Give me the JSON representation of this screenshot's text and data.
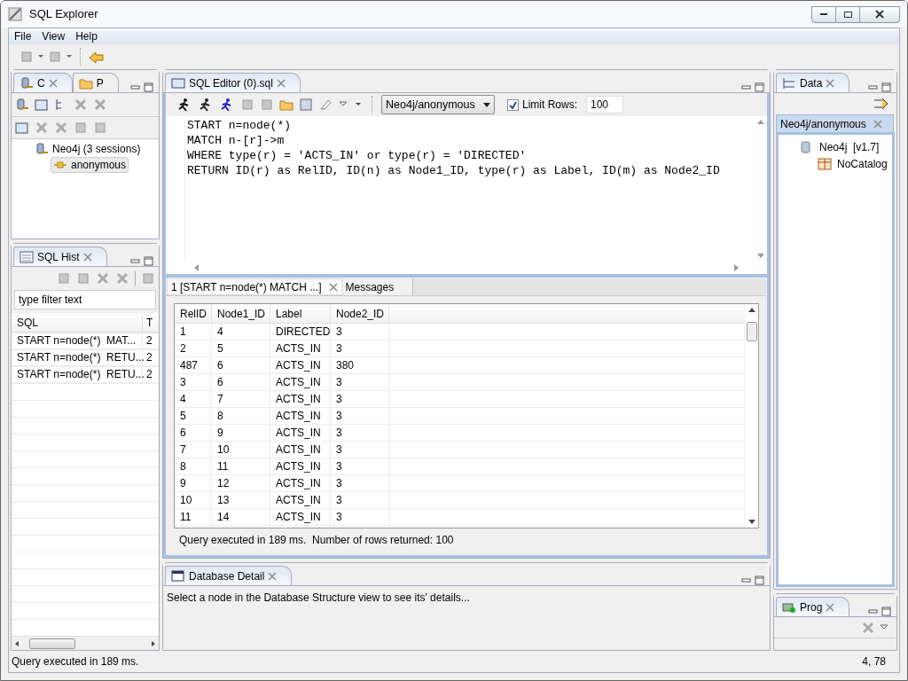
{
  "window": {
    "title": "SQL Explorer"
  },
  "menu": [
    "File",
    "View",
    "Help"
  ],
  "connections_panel": {
    "tabs": [
      {
        "label": "C",
        "selected": true
      },
      {
        "label": "P",
        "selected": false
      }
    ],
    "tree": [
      {
        "label": "Neo4j (3 sessions)",
        "selected": false,
        "children": [
          {
            "label": "anonymous",
            "selected": true
          }
        ]
      }
    ]
  },
  "history_panel": {
    "title": "SQL Hist",
    "filter": {
      "placeholder": "type filter text"
    },
    "columns": [
      "SQL",
      "T"
    ],
    "rows": [
      [
        "START n=node(*)  MAT...",
        "2"
      ],
      [
        "START n=node(*)  RETU...",
        "2"
      ],
      [
        "START n=node(*)  RETU...",
        "2"
      ]
    ]
  },
  "editor": {
    "tab": "SQL Editor (0).sql",
    "connection": "Neo4j/anonymous",
    "limit_rows": {
      "label": "Limit Rows:",
      "checked": true,
      "value": "100"
    },
    "lines": [
      "START n=node(*)",
      "MATCH n-[r]->m",
      "WHERE type(r) = 'ACTS_IN' or type(r) = 'DIRECTED'",
      "RETURN ID(r) as RelID, ID(n) as Node1_ID, type(r) as Label, ID(m) as Node2_ID"
    ]
  },
  "results": {
    "tabs": [
      {
        "label": "1 [START n=node(*) MATCH ...]",
        "selected": true
      },
      {
        "label": "Messages",
        "selected": false
      }
    ],
    "columns": [
      "RelID",
      "Node1_ID",
      "Label",
      "Node2_ID"
    ],
    "rows": [
      [
        "1",
        "4",
        "DIRECTED",
        "3"
      ],
      [
        "2",
        "5",
        "ACTS_IN",
        "3"
      ],
      [
        "487",
        "6",
        "ACTS_IN",
        "380"
      ],
      [
        "3",
        "6",
        "ACTS_IN",
        "3"
      ],
      [
        "4",
        "7",
        "ACTS_IN",
        "3"
      ],
      [
        "5",
        "8",
        "ACTS_IN",
        "3"
      ],
      [
        "6",
        "9",
        "ACTS_IN",
        "3"
      ],
      [
        "7",
        "10",
        "ACTS_IN",
        "3"
      ],
      [
        "8",
        "11",
        "ACTS_IN",
        "3"
      ],
      [
        "9",
        "12",
        "ACTS_IN",
        "3"
      ],
      [
        "10",
        "13",
        "ACTS_IN",
        "3"
      ],
      [
        "11",
        "14",
        "ACTS_IN",
        "3"
      ]
    ],
    "summary": "Query executed in 189 ms.  Number of rows returned: 100"
  },
  "detail_panel": {
    "title": "Database Detail",
    "message": "Select a node in the Database Structure view to see its' details..."
  },
  "data_panel": {
    "title": "Data",
    "subtab": "Neo4j/anonymous",
    "tree": [
      {
        "label": "Neo4j  [v1.7]",
        "children": [
          {
            "label": "NoCatalog"
          }
        ]
      }
    ]
  },
  "progress_panel": {
    "title": "Prog"
  },
  "status_bar": {
    "message": "Query executed in 189 ms.",
    "position": "4, 78"
  }
}
